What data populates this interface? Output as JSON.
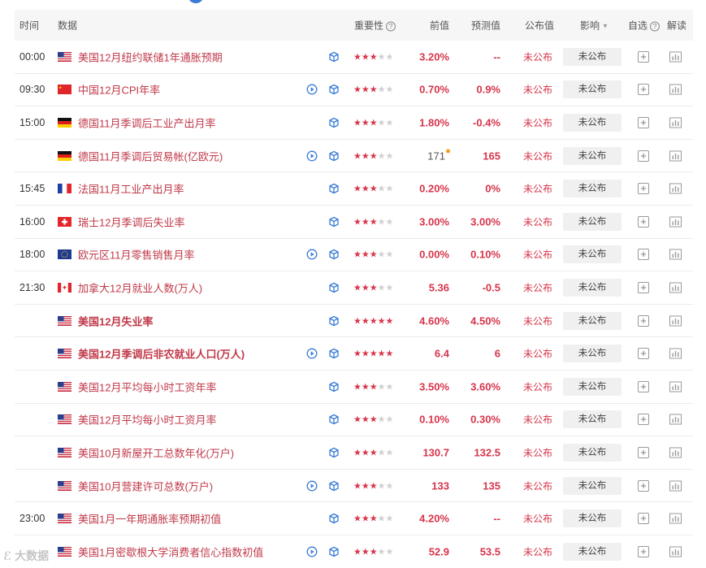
{
  "header": {
    "time": "时间",
    "data": "数据",
    "importance": "重要性",
    "previous": "前值",
    "forecast": "预测值",
    "actual": "公布值",
    "impact": "影响",
    "watchlist": "自选",
    "analysis": "解读"
  },
  "rows": [
    {
      "time": "00:00",
      "flag": "us",
      "name": "美国12月纽约联储1年通胀预期",
      "bold": false,
      "video": false,
      "stars": 3,
      "prev": "3.20%",
      "forecast": "--",
      "actual": "未公布",
      "impact": "未公布"
    },
    {
      "time": "09:30",
      "flag": "cn",
      "name": "中国12月CPI年率",
      "bold": false,
      "video": true,
      "stars": 3,
      "prev": "0.70%",
      "forecast": "0.9%",
      "actual": "未公布",
      "impact": "未公布"
    },
    {
      "time": "15:00",
      "flag": "de",
      "name": "德国11月季调后工业产出月率",
      "bold": false,
      "video": false,
      "stars": 3,
      "prev": "1.80%",
      "forecast": "-0.4%",
      "actual": "未公布",
      "impact": "未公布"
    },
    {
      "time": "",
      "flag": "de",
      "name": "德国11月季调后贸易帐(亿欧元)",
      "bold": false,
      "video": true,
      "stars": 3,
      "prev": "171",
      "prev_neutral": true,
      "forecast": "165",
      "actual": "未公布",
      "impact": "未公布"
    },
    {
      "time": "15:45",
      "flag": "fr",
      "name": "法国11月工业产出月率",
      "bold": false,
      "video": false,
      "stars": 3,
      "prev": "0.20%",
      "forecast": "0%",
      "actual": "未公布",
      "impact": "未公布"
    },
    {
      "time": "16:00",
      "flag": "ch",
      "name": "瑞士12月季调后失业率",
      "bold": false,
      "video": false,
      "stars": 3,
      "prev": "3.00%",
      "forecast": "3.00%",
      "actual": "未公布",
      "impact": "未公布"
    },
    {
      "time": "18:00",
      "flag": "eu",
      "name": "欧元区11月零售销售月率",
      "bold": false,
      "video": true,
      "stars": 3,
      "prev": "0.00%",
      "forecast": "0.10%",
      "actual": "未公布",
      "impact": "未公布"
    },
    {
      "time": "21:30",
      "flag": "ca",
      "name": "加拿大12月就业人数(万人)",
      "bold": false,
      "video": false,
      "stars": 3,
      "prev": "5.36",
      "forecast": "-0.5",
      "actual": "未公布",
      "impact": "未公布"
    },
    {
      "time": "",
      "flag": "us",
      "name": "美国12月失业率",
      "bold": true,
      "video": false,
      "stars": 5,
      "prev": "4.60%",
      "forecast": "4.50%",
      "actual": "未公布",
      "impact": "未公布"
    },
    {
      "time": "",
      "flag": "us",
      "name": "美国12月季调后非农就业人口(万人)",
      "bold": true,
      "video": true,
      "stars": 5,
      "prev": "6.4",
      "forecast": "6",
      "actual": "未公布",
      "impact": "未公布"
    },
    {
      "time": "",
      "flag": "us",
      "name": "美国12月平均每小时工资年率",
      "bold": false,
      "video": false,
      "stars": 3,
      "prev": "3.50%",
      "forecast": "3.60%",
      "actual": "未公布",
      "impact": "未公布"
    },
    {
      "time": "",
      "flag": "us",
      "name": "美国12月平均每小时工资月率",
      "bold": false,
      "video": false,
      "stars": 3,
      "prev": "0.10%",
      "forecast": "0.30%",
      "actual": "未公布",
      "impact": "未公布"
    },
    {
      "time": "",
      "flag": "us",
      "name": "美国10月新屋开工总数年化(万户)",
      "bold": false,
      "video": false,
      "stars": 3,
      "prev": "130.7",
      "forecast": "132.5",
      "actual": "未公布",
      "impact": "未公布"
    },
    {
      "time": "",
      "flag": "us",
      "name": "美国10月营建许可总数(万户)",
      "bold": false,
      "video": true,
      "stars": 3,
      "prev": "133",
      "forecast": "135",
      "actual": "未公布",
      "impact": "未公布"
    },
    {
      "time": "23:00",
      "flag": "us",
      "name": "美国1月一年期通胀率预期初值",
      "bold": false,
      "video": false,
      "stars": 3,
      "prev": "4.20%",
      "forecast": "--",
      "actual": "未公布",
      "impact": "未公布"
    },
    {
      "time": "",
      "flag": "us",
      "name": "美国1月密歇根大学消费者信心指数初值",
      "bold": false,
      "video": true,
      "stars": 3,
      "prev": "52.9",
      "forecast": "53.5",
      "actual": "未公布",
      "impact": "未公布"
    }
  ],
  "watermark": "大数据",
  "colors": {
    "accent": "#d6354b",
    "header_bg": "#f6f6f6",
    "impact_bg": "#f0f0f0"
  }
}
